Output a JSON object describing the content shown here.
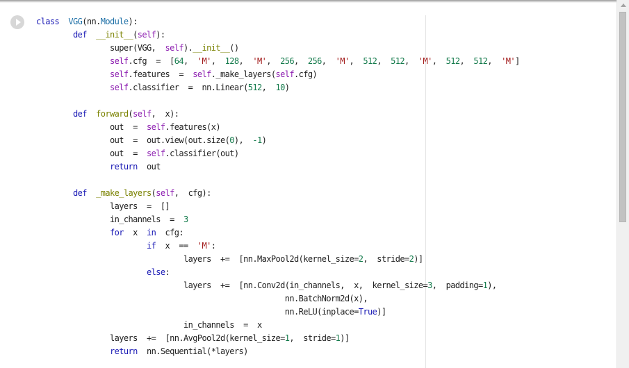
{
  "notebook": {
    "run_button_icon": "play-icon"
  },
  "code_lines": [
    [
      [
        "class",
        "kw"
      ],
      [
        "  ",
        ""
      ],
      [
        "VGG",
        "cls"
      ],
      [
        "(nn.",
        ""
      ],
      [
        "Module",
        "cls"
      ],
      [
        "):",
        ""
      ]
    ],
    [
      [
        "        ",
        ""
      ],
      [
        "def",
        "kw"
      ],
      [
        "  ",
        ""
      ],
      [
        "__init__",
        "def"
      ],
      [
        "(",
        ""
      ],
      [
        "self",
        "self"
      ],
      [
        "):",
        ""
      ]
    ],
    [
      [
        "                ",
        ""
      ],
      [
        "super(VGG,  ",
        ""
      ],
      [
        "self",
        "self"
      ],
      [
        ").",
        ""
      ],
      [
        "__init__",
        "def"
      ],
      [
        "()",
        ""
      ]
    ],
    [
      [
        "                ",
        ""
      ],
      [
        "self",
        "self"
      ],
      [
        ".cfg  =  [",
        ""
      ],
      [
        "64",
        "num"
      ],
      [
        ",  ",
        ""
      ],
      [
        "'M'",
        "str"
      ],
      [
        ",  ",
        ""
      ],
      [
        "128",
        "num"
      ],
      [
        ",  ",
        ""
      ],
      [
        "'M'",
        "str"
      ],
      [
        ",  ",
        ""
      ],
      [
        "256",
        "num"
      ],
      [
        ",  ",
        ""
      ],
      [
        "256",
        "num"
      ],
      [
        ",  ",
        ""
      ],
      [
        "'M'",
        "str"
      ],
      [
        ",  ",
        ""
      ],
      [
        "512",
        "num"
      ],
      [
        ",  ",
        ""
      ],
      [
        "512",
        "num"
      ],
      [
        ",  ",
        ""
      ],
      [
        "'M'",
        "str"
      ],
      [
        ",  ",
        ""
      ],
      [
        "512",
        "num"
      ],
      [
        ",  ",
        ""
      ],
      [
        "512",
        "num"
      ],
      [
        ",  ",
        ""
      ],
      [
        "'M'",
        "str"
      ],
      [
        "]",
        ""
      ]
    ],
    [
      [
        "                ",
        ""
      ],
      [
        "self",
        "self"
      ],
      [
        ".features  =  ",
        ""
      ],
      [
        "self",
        "self"
      ],
      [
        "._make_layers(",
        ""
      ],
      [
        "self",
        "self"
      ],
      [
        ".cfg)",
        ""
      ]
    ],
    [
      [
        "                ",
        ""
      ],
      [
        "self",
        "self"
      ],
      [
        ".classifier  =  nn.Linear(",
        ""
      ],
      [
        "512",
        "num"
      ],
      [
        ",  ",
        ""
      ],
      [
        "10",
        "num"
      ],
      [
        ")",
        ""
      ]
    ],
    [
      [
        "",
        ""
      ]
    ],
    [
      [
        "        ",
        ""
      ],
      [
        "def",
        "kw"
      ],
      [
        "  ",
        ""
      ],
      [
        "forward",
        "def"
      ],
      [
        "(",
        ""
      ],
      [
        "self",
        "self"
      ],
      [
        ",  x):",
        ""
      ]
    ],
    [
      [
        "                ",
        ""
      ],
      [
        "out  =  ",
        ""
      ],
      [
        "self",
        "self"
      ],
      [
        ".features(x)",
        ""
      ]
    ],
    [
      [
        "                ",
        ""
      ],
      [
        "out  =  out.view(out.size(",
        ""
      ],
      [
        "0",
        "num"
      ],
      [
        "),  ",
        ""
      ],
      [
        "-1",
        "num"
      ],
      [
        ")",
        ""
      ]
    ],
    [
      [
        "                ",
        ""
      ],
      [
        "out  =  ",
        ""
      ],
      [
        "self",
        "self"
      ],
      [
        ".classifier(out)",
        ""
      ]
    ],
    [
      [
        "                ",
        ""
      ],
      [
        "return",
        "kw"
      ],
      [
        "  out",
        ""
      ]
    ],
    [
      [
        "",
        ""
      ]
    ],
    [
      [
        "        ",
        ""
      ],
      [
        "def",
        "kw"
      ],
      [
        "  ",
        ""
      ],
      [
        "_make_layers",
        "def"
      ],
      [
        "(",
        ""
      ],
      [
        "self",
        "self"
      ],
      [
        ",  cfg):",
        ""
      ]
    ],
    [
      [
        "                ",
        ""
      ],
      [
        "layers  =  []",
        ""
      ]
    ],
    [
      [
        "                ",
        ""
      ],
      [
        "in_channels  =  ",
        ""
      ],
      [
        "3",
        "num"
      ]
    ],
    [
      [
        "                ",
        ""
      ],
      [
        "for",
        "kw"
      ],
      [
        "  x  ",
        ""
      ],
      [
        "in",
        "kw"
      ],
      [
        "  cfg:",
        ""
      ]
    ],
    [
      [
        "                        ",
        ""
      ],
      [
        "if",
        "kw"
      ],
      [
        "  x  ==  ",
        ""
      ],
      [
        "'M'",
        "str"
      ],
      [
        ":",
        ""
      ]
    ],
    [
      [
        "                                ",
        ""
      ],
      [
        "layers  +=  [nn.MaxPool2d(kernel_size=",
        ""
      ],
      [
        "2",
        "num"
      ],
      [
        ",  stride=",
        ""
      ],
      [
        "2",
        "num"
      ],
      [
        ")]",
        ""
      ]
    ],
    [
      [
        "                        ",
        ""
      ],
      [
        "else",
        "kw"
      ],
      [
        ":",
        ""
      ]
    ],
    [
      [
        "                                ",
        ""
      ],
      [
        "layers  +=  [nn.Conv2d(in_channels,  x,  kernel_size=",
        ""
      ],
      [
        "3",
        "num"
      ],
      [
        ",  padding=",
        ""
      ],
      [
        "1",
        "num"
      ],
      [
        "),",
        ""
      ]
    ],
    [
      [
        "                                                      ",
        ""
      ],
      [
        "nn.BatchNorm2d(x),",
        ""
      ]
    ],
    [
      [
        "                                                      ",
        ""
      ],
      [
        "nn.ReLU(inplace=",
        ""
      ],
      [
        "True",
        "kw"
      ],
      [
        ")]",
        ""
      ]
    ],
    [
      [
        "                                ",
        ""
      ],
      [
        "in_channels  =  x",
        ""
      ]
    ],
    [
      [
        "                ",
        ""
      ],
      [
        "layers  +=  [nn.AvgPool2d(kernel_size=",
        ""
      ],
      [
        "1",
        "num"
      ],
      [
        ",  stride=",
        ""
      ],
      [
        "1",
        "num"
      ],
      [
        ")]",
        ""
      ]
    ],
    [
      [
        "                ",
        ""
      ],
      [
        "return",
        "kw"
      ],
      [
        "  nn.Sequential(*layers)",
        ""
      ]
    ]
  ]
}
